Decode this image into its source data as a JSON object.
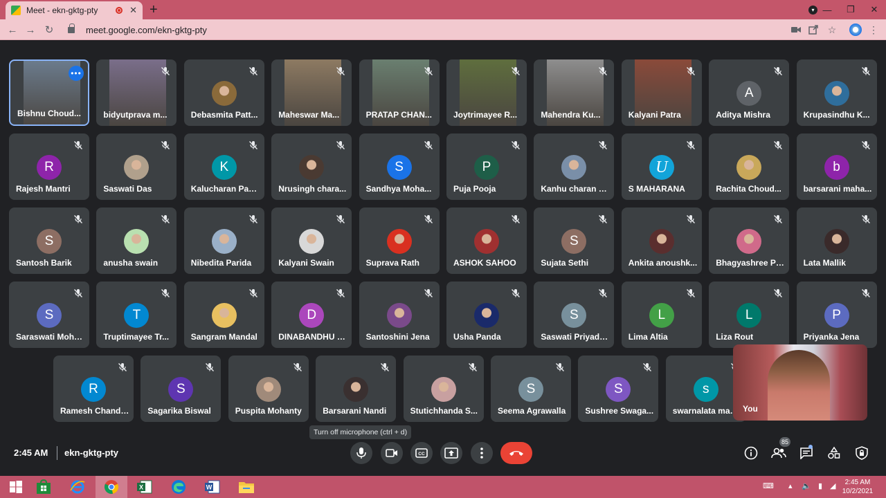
{
  "browser": {
    "tab_title": "Meet - ekn-gktg-pty",
    "url": "meet.google.com/ekn-gktg-pty"
  },
  "meeting": {
    "time": "2:45 AM",
    "code": "ekn-gktg-pty",
    "participant_count": "85",
    "tooltip": "Turn off microphone (ctrl + d)",
    "self_label": "You"
  },
  "participants": [
    {
      "name": "Bishnu Choud...",
      "kind": "video",
      "bg": "#6b7b8c",
      "active": true
    },
    {
      "name": "bidyutprava m...",
      "kind": "video",
      "bg": "#7a6e8a"
    },
    {
      "name": "Debasmita Patt...",
      "kind": "photo",
      "bg": "#8a6a3a"
    },
    {
      "name": "Maheswar Ma...",
      "kind": "video",
      "bg": "#8d7a62"
    },
    {
      "name": "PRATAP CHAN...",
      "kind": "video",
      "bg": "#6a7f70"
    },
    {
      "name": "Joytrimayee R...",
      "kind": "video",
      "bg": "#5f6e3e"
    },
    {
      "name": "Mahendra Ku...",
      "kind": "video",
      "bg": "#8e8e8e"
    },
    {
      "name": "Kalyani Patra",
      "kind": "video",
      "bg": "#8a4a3a"
    },
    {
      "name": "Aditya Mishra",
      "kind": "letter",
      "letter": "A",
      "bg": "#5f6368"
    },
    {
      "name": "Krupasindhu K...",
      "kind": "photo",
      "bg": "#2f6e9c"
    },
    {
      "name": "Rajesh Mantri",
      "kind": "letter",
      "letter": "R",
      "bg": "#8e24aa"
    },
    {
      "name": "Saswati Das",
      "kind": "photo",
      "bg": "#b0a08c"
    },
    {
      "name": "Kalucharan Pad...",
      "kind": "letter",
      "letter": "K",
      "bg": "#0097a7"
    },
    {
      "name": "Nrusingh chara...",
      "kind": "photo",
      "bg": "#4a3a32"
    },
    {
      "name": "Sandhya Moha...",
      "kind": "letter",
      "letter": "S",
      "bg": "#1a73e8"
    },
    {
      "name": "Puja Pooja",
      "kind": "letter",
      "letter": "P",
      "bg": "#1e5e48"
    },
    {
      "name": "Kanhu charan B...",
      "kind": "photo",
      "bg": "#7a8fa8"
    },
    {
      "name": "S MAHARANA",
      "kind": "letter",
      "letter": "U",
      "bg": "#12a4d9"
    },
    {
      "name": "Rachita Choud...",
      "kind": "photo",
      "bg": "#c9a85a"
    },
    {
      "name": "barsarani maha...",
      "kind": "letter",
      "letter": "b",
      "bg": "#8e24aa"
    },
    {
      "name": "Santosh Barik",
      "kind": "letter",
      "letter": "S",
      "bg": "#8d6e63"
    },
    {
      "name": "anusha swain",
      "kind": "photo",
      "bg": "#b9e0b0"
    },
    {
      "name": "Nibedita Parida",
      "kind": "photo",
      "bg": "#9ab0c8"
    },
    {
      "name": "Kalyani Swain",
      "kind": "photo",
      "bg": "#d8d8d8"
    },
    {
      "name": "Suprava Rath",
      "kind": "photo",
      "bg": "#d93020"
    },
    {
      "name": "ASHOK SAHOO",
      "kind": "photo",
      "bg": "#a03030"
    },
    {
      "name": "Sujata Sethi",
      "kind": "letter",
      "letter": "S",
      "bg": "#8d6e63"
    },
    {
      "name": "Ankita anoushk...",
      "kind": "photo",
      "bg": "#5a2e2e"
    },
    {
      "name": "Bhagyashree Pr...",
      "kind": "photo",
      "bg": "#d06a8a"
    },
    {
      "name": "Lata Mallik",
      "kind": "photo",
      "bg": "#3a2a2a"
    },
    {
      "name": "Saraswati Moha...",
      "kind": "letter",
      "letter": "S",
      "bg": "#5c6bc0"
    },
    {
      "name": "Truptimayee Tr...",
      "kind": "letter",
      "letter": "T",
      "bg": "#0288d1"
    },
    {
      "name": "Sangram Mandal",
      "kind": "photo",
      "bg": "#e8c060"
    },
    {
      "name": "DINABANDHU S...",
      "kind": "letter",
      "letter": "D",
      "bg": "#ab47bc"
    },
    {
      "name": "Santoshini Jena",
      "kind": "photo",
      "bg": "#7a4a8a"
    },
    {
      "name": "Usha Panda",
      "kind": "photo",
      "bg": "#1a2a6a"
    },
    {
      "name": "Saswati Priyada...",
      "kind": "letter",
      "letter": "S",
      "bg": "#78909c"
    },
    {
      "name": "Lima Altia",
      "kind": "letter",
      "letter": "L",
      "bg": "#43a047"
    },
    {
      "name": "Liza Rout",
      "kind": "letter",
      "letter": "L",
      "bg": "#00796b"
    },
    {
      "name": "Priyanka Jena",
      "kind": "letter",
      "letter": "P",
      "bg": "#5c6bc0"
    },
    {
      "name": "Ramesh Chandr...",
      "kind": "letter",
      "letter": "R",
      "bg": "#0288d1"
    },
    {
      "name": "Sagarika Biswal",
      "kind": "letter",
      "letter": "S",
      "bg": "#5e35b1"
    },
    {
      "name": "Puspita Mohanty",
      "kind": "photo",
      "bg": "#a08a7a"
    },
    {
      "name": "Barsarani Nandi",
      "kind": "photo",
      "bg": "#3a3030"
    },
    {
      "name": "Stutichhanda S...",
      "kind": "photo",
      "bg": "#c8a0a0"
    },
    {
      "name": "Seema Agrawalla",
      "kind": "letter",
      "letter": "S",
      "bg": "#78909c"
    },
    {
      "name": "Sushree Swaga...",
      "kind": "letter",
      "letter": "S",
      "bg": "#7e57c2"
    },
    {
      "name": "swarnalata mah...",
      "kind": "letter",
      "letter": "s",
      "bg": "#0097a7"
    }
  ],
  "taskbar": {
    "clock_time": "2:45 AM",
    "clock_date": "10/2/2021"
  },
  "colors": {
    "background": "#202124",
    "tile": "#3c4043",
    "end_call": "#ea4335",
    "chrome_tab_strip": "#c4566a",
    "taskbar": "#c0536a"
  }
}
